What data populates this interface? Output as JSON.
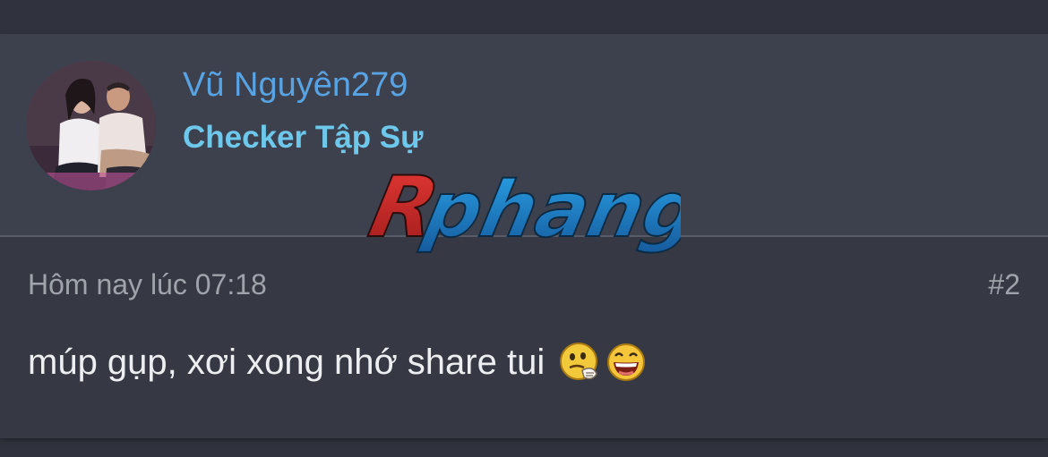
{
  "post": {
    "author_name": "Vũ Nguyên279",
    "author_title": "Checker Tập Sự",
    "timestamp": "Hôm nay lúc 07:18",
    "post_number": "#2",
    "message": "múp gụp, xơi xong nhớ share tui",
    "emojis": [
      "thinking-smiley-icon",
      "laughing-smiley-icon"
    ]
  },
  "watermark": {
    "text": "Rphang",
    "colors": {
      "r": "#c62828",
      "rest": "#1f8fd6"
    }
  },
  "colors": {
    "background": "#30333d",
    "card": "#363943",
    "card_header": "#3d414d",
    "username": "#58a3e3",
    "user_title": "#6ec8ec",
    "meta_text": "#9fa3ab",
    "message_text": "#eceef1"
  }
}
